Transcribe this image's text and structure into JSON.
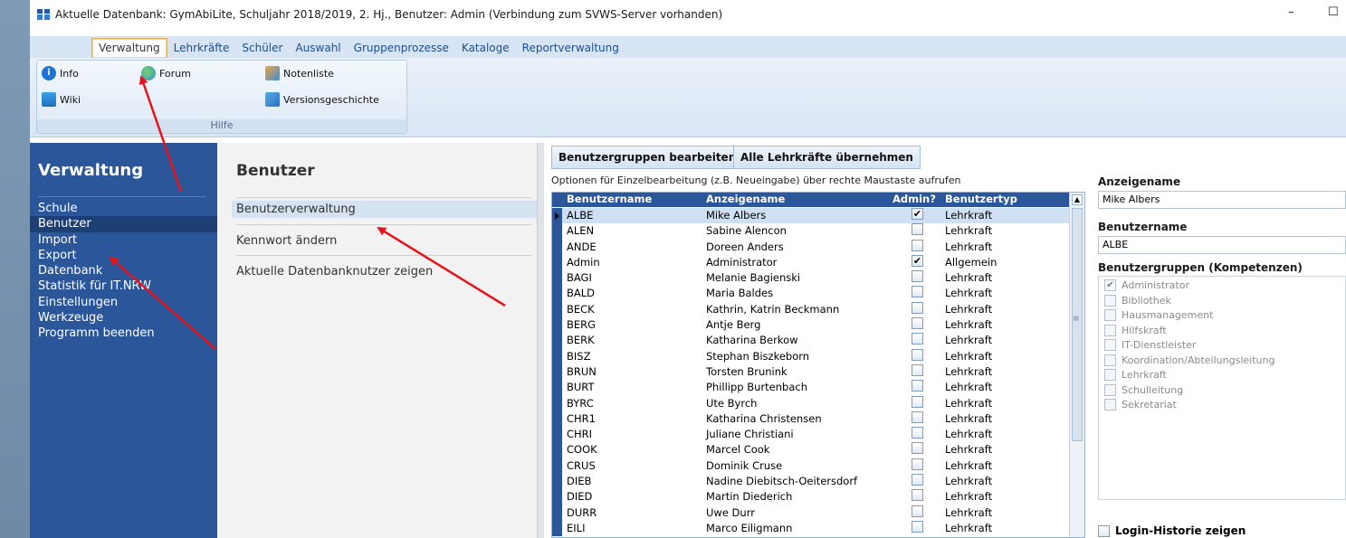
{
  "window": {
    "title": "Aktuelle Datenbank: GymAbiLite, Schuljahr 2018/2019, 2. Hj., Benutzer: Admin (Verbindung zum SVWS-Server vorhanden)",
    "minimize_glyph": "–",
    "maximize_glyph": "☐"
  },
  "ribbon": {
    "tabs": [
      "Verwaltung",
      "Lehrkräfte",
      "Schüler",
      "Auswahl",
      "Gruppenprozesse",
      "Kataloge",
      "Reportverwaltung"
    ],
    "active_tab": "Verwaltung",
    "buttons": {
      "info": "Info",
      "forum": "Forum",
      "notenliste": "Notenliste",
      "wiki": "Wiki",
      "versionsgeschichte": "Versionsgeschichte"
    },
    "group_label": "Hilfe"
  },
  "nav": {
    "title": "Verwaltung",
    "items": [
      "Schule",
      "Benutzer",
      "Import",
      "Export",
      "Datenbank",
      "Statistik für IT.NRW",
      "Einstellungen",
      "Werkzeuge",
      "Programm beenden"
    ],
    "selected": "Benutzer"
  },
  "mid": {
    "title": "Benutzer",
    "items": [
      "Benutzerverwaltung",
      "Kennwort ändern",
      "Aktuelle Datenbanknutzer zeigen"
    ],
    "selected": "Benutzerverwaltung"
  },
  "toolbar": {
    "groups_button": "Benutzergruppen bearbeiten",
    "adopt_button": "Alle Lehrkräfte übernehmen",
    "hint": "Optionen für Einzelbearbeitung (z.B. Neueingabe) über rechte Maustaste aufrufen"
  },
  "grid": {
    "columns": [
      "Benutzername",
      "Anzeigename",
      "Admin?",
      "Benutzertyp"
    ],
    "rows": [
      {
        "user": "ALBE",
        "name": "Mike Albers",
        "admin": true,
        "type": "Lehrkraft"
      },
      {
        "user": "ALEN",
        "name": "Sabine Alencon",
        "admin": false,
        "type": "Lehrkraft"
      },
      {
        "user": "ANDE",
        "name": "Doreen Anders",
        "admin": false,
        "type": "Lehrkraft"
      },
      {
        "user": "Admin",
        "name": "Administrator",
        "admin": true,
        "type": "Allgemein"
      },
      {
        "user": "BAGI",
        "name": "Melanie Bagienski",
        "admin": false,
        "type": "Lehrkraft"
      },
      {
        "user": "BALD",
        "name": "Maria Baldes",
        "admin": false,
        "type": "Lehrkraft"
      },
      {
        "user": "BECK",
        "name": "Kathrin, Katrin Beckmann",
        "admin": false,
        "type": "Lehrkraft"
      },
      {
        "user": "BERG",
        "name": "Antje Berg",
        "admin": false,
        "type": "Lehrkraft"
      },
      {
        "user": "BERK",
        "name": "Katharina Berkow",
        "admin": false,
        "type": "Lehrkraft"
      },
      {
        "user": "BISZ",
        "name": "Stephan Biszkeborn",
        "admin": false,
        "type": "Lehrkraft"
      },
      {
        "user": "BRUN",
        "name": "Torsten Brunink",
        "admin": false,
        "type": "Lehrkraft"
      },
      {
        "user": "BURT",
        "name": "Phillipp Burtenbach",
        "admin": false,
        "type": "Lehrkraft"
      },
      {
        "user": "BYRC",
        "name": "Ute Byrch",
        "admin": false,
        "type": "Lehrkraft"
      },
      {
        "user": "CHR1",
        "name": "Katharina Christensen",
        "admin": false,
        "type": "Lehrkraft"
      },
      {
        "user": "CHRI",
        "name": "Juliane Christiani",
        "admin": false,
        "type": "Lehrkraft"
      },
      {
        "user": "COOK",
        "name": "Marcel Cook",
        "admin": false,
        "type": "Lehrkraft"
      },
      {
        "user": "CRUS",
        "name": "Dominik Cruse",
        "admin": false,
        "type": "Lehrkraft"
      },
      {
        "user": "DIEB",
        "name": "Nadine Diebitsch-Oeitersdorf",
        "admin": false,
        "type": "Lehrkraft"
      },
      {
        "user": "DIED",
        "name": "Martin Diederich",
        "admin": false,
        "type": "Lehrkraft"
      },
      {
        "user": "DURR",
        "name": "Uwe Durr",
        "admin": false,
        "type": "Lehrkraft"
      },
      {
        "user": "EILI",
        "name": "Marco Eiligmann",
        "admin": false,
        "type": "Lehrkraft"
      }
    ],
    "selected_index": 0
  },
  "detail": {
    "anzeigename_label": "Anzeigename",
    "anzeigename_value": "Mike Albers",
    "benutzername_label": "Benutzername",
    "benutzername_value": "ALBE",
    "groups_label": "Benutzergruppen (Kompetenzen)",
    "groups": [
      {
        "label": "Administrator",
        "checked": true
      },
      {
        "label": "Bibliothek",
        "checked": false
      },
      {
        "label": "Hausmanagement",
        "checked": false
      },
      {
        "label": "Hilfskraft",
        "checked": false
      },
      {
        "label": "IT-Dienstleister",
        "checked": false
      },
      {
        "label": "Koordination/Abteilungsleitung",
        "checked": false
      },
      {
        "label": "Lehrkraft",
        "checked": false
      },
      {
        "label": "Schulleitung",
        "checked": false
      },
      {
        "label": "Sekretariat",
        "checked": false
      }
    ],
    "login_history_label": "Login-Historie zeigen"
  },
  "colors": {
    "nav_blue": "#2b579a",
    "nav_selected": "#1d3f73",
    "annotation_red": "#e8141b"
  },
  "icons": {
    "info": "info-icon",
    "forum": "globe-icon",
    "notenliste": "grades-list-icon",
    "wiki": "wiki-icon",
    "versionsgeschichte": "version-history-icon"
  }
}
